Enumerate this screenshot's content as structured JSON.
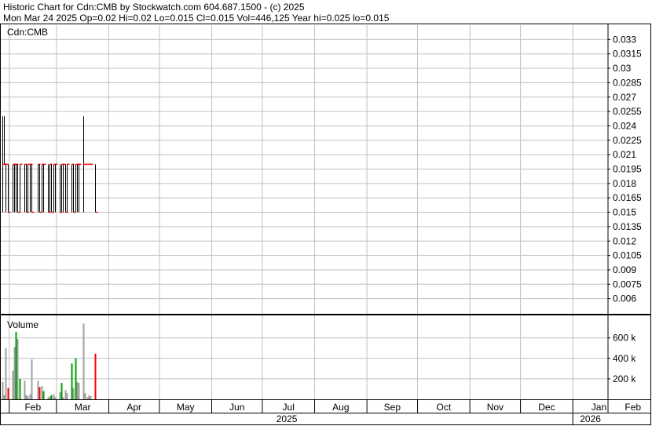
{
  "header": {
    "line1": "Historic Chart for Cdn:CMB by Stockwatch.com 604.687.1500 - (c) 2025",
    "line2": "Mon Mar 24 2025   Op=0.02   Hi=0.02   Lo=0.015   Cl=0.015   Vol=446,125   Year hi=0.025   lo=0.015"
  },
  "price_panel": {
    "symbol_label": "Cdn:CMB"
  },
  "volume_panel": {
    "label": "Volume"
  },
  "colors": {
    "grid": "#c0c0c0",
    "frame": "#000000",
    "price_bar": "#000000",
    "close_tick": "#ff0000",
    "vol_up": "#00a000",
    "vol_down": "#ff0000",
    "vol_flat": "#a0a0a0"
  },
  "chart_data": [
    {
      "type": "ohlc",
      "ylim": [
        0.0045,
        0.0345
      ],
      "yticks": [
        "0.033",
        "0.0315",
        "0.03",
        "0.0285",
        "0.027",
        "0.0255",
        "0.024",
        "0.0225",
        "0.021",
        "0.0195",
        "0.018",
        "0.0165",
        "0.015",
        "0.0135",
        "0.012",
        "0.0105",
        "0.009",
        "0.0075",
        "0.006"
      ],
      "x_months": [
        "Feb",
        "Mar",
        "Apr",
        "May",
        "Jun",
        "Jul",
        "Aug",
        "Sep",
        "Oct",
        "Nov",
        "Dec",
        "Jan",
        "Feb"
      ],
      "x_years": [
        "2025",
        "2026"
      ],
      "bars": [
        {
          "date": "2025-01-28",
          "high": 0.025,
          "low": 0.015,
          "close": 0.02
        },
        {
          "date": "2025-01-29",
          "high": 0.025,
          "low": 0.02,
          "close": 0.02
        },
        {
          "date": "2025-01-30",
          "high": 0.02,
          "low": 0.015,
          "close": 0.02
        },
        {
          "date": "2025-01-31",
          "high": 0.02,
          "low": 0.015,
          "close": 0.015
        },
        {
          "date": "2025-02-03",
          "high": 0.02,
          "low": 0.015,
          "close": 0.02
        },
        {
          "date": "2025-02-04",
          "high": 0.02,
          "low": 0.015,
          "close": 0.02
        },
        {
          "date": "2025-02-05",
          "high": 0.02,
          "low": 0.015,
          "close": 0.02
        },
        {
          "date": "2025-02-06",
          "high": 0.02,
          "low": 0.015,
          "close": 0.015
        },
        {
          "date": "2025-02-07",
          "high": 0.02,
          "low": 0.015,
          "close": 0.02
        },
        {
          "date": "2025-02-10",
          "high": 0.02,
          "low": 0.015,
          "close": 0.02
        },
        {
          "date": "2025-02-11",
          "high": 0.02,
          "low": 0.015,
          "close": 0.015
        },
        {
          "date": "2025-02-12",
          "high": 0.02,
          "low": 0.015,
          "close": 0.02
        },
        {
          "date": "2025-02-13",
          "high": 0.02,
          "low": 0.015,
          "close": 0.02
        },
        {
          "date": "2025-02-14",
          "high": 0.02,
          "low": 0.015,
          "close": 0.015
        },
        {
          "date": "2025-02-18",
          "high": 0.02,
          "low": 0.015,
          "close": 0.02
        },
        {
          "date": "2025-02-19",
          "high": 0.02,
          "low": 0.015,
          "close": 0.015
        },
        {
          "date": "2025-02-20",
          "high": 0.02,
          "low": 0.015,
          "close": 0.02
        },
        {
          "date": "2025-02-21",
          "high": 0.02,
          "low": 0.015,
          "close": 0.02
        },
        {
          "date": "2025-02-24",
          "high": 0.02,
          "low": 0.015,
          "close": 0.015
        },
        {
          "date": "2025-02-25",
          "high": 0.02,
          "low": 0.015,
          "close": 0.02
        },
        {
          "date": "2025-02-26",
          "high": 0.02,
          "low": 0.015,
          "close": 0.015
        },
        {
          "date": "2025-02-27",
          "high": 0.02,
          "low": 0.015,
          "close": 0.02
        },
        {
          "date": "2025-02-28",
          "high": 0.02,
          "low": 0.015,
          "close": 0.02
        },
        {
          "date": "2025-03-03",
          "high": 0.02,
          "low": 0.015,
          "close": 0.015
        },
        {
          "date": "2025-03-04",
          "high": 0.02,
          "low": 0.015,
          "close": 0.02
        },
        {
          "date": "2025-03-05",
          "high": 0.02,
          "low": 0.015,
          "close": 0.02
        },
        {
          "date": "2025-03-06",
          "high": 0.02,
          "low": 0.015,
          "close": 0.015
        },
        {
          "date": "2025-03-07",
          "high": 0.02,
          "low": 0.015,
          "close": 0.02
        },
        {
          "date": "2025-03-10",
          "high": 0.02,
          "low": 0.015,
          "close": 0.02
        },
        {
          "date": "2025-03-11",
          "high": 0.02,
          "low": 0.015,
          "close": 0.015
        },
        {
          "date": "2025-03-12",
          "high": 0.02,
          "low": 0.015,
          "close": 0.02
        },
        {
          "date": "2025-03-13",
          "high": 0.02,
          "low": 0.015,
          "close": 0.02
        },
        {
          "date": "2025-03-14",
          "high": 0.02,
          "low": 0.015,
          "close": 0.02
        },
        {
          "date": "2025-03-17",
          "high": 0.025,
          "low": 0.015,
          "close": 0.02
        },
        {
          "date": "2025-03-18",
          "high": 0.02,
          "low": 0.02,
          "close": 0.02
        },
        {
          "date": "2025-03-19",
          "high": 0.02,
          "low": 0.02,
          "close": 0.02
        },
        {
          "date": "2025-03-20",
          "high": 0.02,
          "low": 0.02,
          "close": 0.02
        },
        {
          "date": "2025-03-21",
          "high": 0.02,
          "low": 0.02,
          "close": 0.02
        },
        {
          "date": "2025-03-24",
          "high": 0.02,
          "low": 0.015,
          "close": 0.015
        }
      ]
    },
    {
      "type": "bar",
      "ylim": [
        0,
        820000
      ],
      "yticks": [
        {
          "value": 600000,
          "label": "600 k"
        },
        {
          "value": 400000,
          "label": "400 k"
        },
        {
          "value": 200000,
          "label": "200 k"
        }
      ],
      "bars": [
        {
          "date": "2025-01-28",
          "value": 170000,
          "dir": "flat"
        },
        {
          "date": "2025-01-29",
          "value": 40000,
          "dir": "flat"
        },
        {
          "date": "2025-01-30",
          "value": 500000,
          "dir": "flat"
        },
        {
          "date": "2025-01-31",
          "value": 110000,
          "dir": "down"
        },
        {
          "date": "2025-02-03",
          "value": 280000,
          "dir": "flat"
        },
        {
          "date": "2025-02-04",
          "value": 510000,
          "dir": "flat"
        },
        {
          "date": "2025-02-05",
          "value": 660000,
          "dir": "up"
        },
        {
          "date": "2025-02-06",
          "value": 590000,
          "dir": "flat"
        },
        {
          "date": "2025-02-07",
          "value": 200000,
          "dir": "up"
        },
        {
          "date": "2025-02-10",
          "value": 180000,
          "dir": "flat"
        },
        {
          "date": "2025-02-11",
          "value": 40000,
          "dir": "flat"
        },
        {
          "date": "2025-02-12",
          "value": 30000,
          "dir": "flat"
        },
        {
          "date": "2025-02-13",
          "value": 50000,
          "dir": "flat"
        },
        {
          "date": "2025-02-14",
          "value": 390000,
          "dir": "flat"
        },
        {
          "date": "2025-02-18",
          "value": 180000,
          "dir": "flat"
        },
        {
          "date": "2025-02-19",
          "value": 120000,
          "dir": "down"
        },
        {
          "date": "2025-02-20",
          "value": 130000,
          "dir": "flat"
        },
        {
          "date": "2025-02-21",
          "value": 80000,
          "dir": "up"
        },
        {
          "date": "2025-02-24",
          "value": 20000,
          "dir": "flat"
        },
        {
          "date": "2025-02-25",
          "value": 30000,
          "dir": "flat"
        },
        {
          "date": "2025-02-26",
          "value": 40000,
          "dir": "up"
        },
        {
          "date": "2025-02-27",
          "value": 50000,
          "dir": "flat"
        },
        {
          "date": "2025-02-28",
          "value": 20000,
          "dir": "flat"
        },
        {
          "date": "2025-03-03",
          "value": 70000,
          "dir": "flat"
        },
        {
          "date": "2025-03-04",
          "value": 160000,
          "dir": "up"
        },
        {
          "date": "2025-03-05",
          "value": 20000,
          "dir": "flat"
        },
        {
          "date": "2025-03-06",
          "value": 90000,
          "dir": "flat"
        },
        {
          "date": "2025-03-07",
          "value": 60000,
          "dir": "flat"
        },
        {
          "date": "2025-03-10",
          "value": 350000,
          "dir": "up"
        },
        {
          "date": "2025-03-11",
          "value": 110000,
          "dir": "flat"
        },
        {
          "date": "2025-03-12",
          "value": 400000,
          "dir": "up"
        },
        {
          "date": "2025-03-13",
          "value": 170000,
          "dir": "flat"
        },
        {
          "date": "2025-03-14",
          "value": 160000,
          "dir": "flat"
        },
        {
          "date": "2025-03-17",
          "value": 740000,
          "dir": "flat"
        },
        {
          "date": "2025-03-18",
          "value": 60000,
          "dir": "flat"
        },
        {
          "date": "2025-03-19",
          "value": 20000,
          "dir": "flat"
        },
        {
          "date": "2025-03-20",
          "value": 40000,
          "dir": "flat"
        },
        {
          "date": "2025-03-21",
          "value": 30000,
          "dir": "flat"
        },
        {
          "date": "2025-03-24",
          "value": 446125,
          "dir": "down"
        }
      ]
    }
  ]
}
